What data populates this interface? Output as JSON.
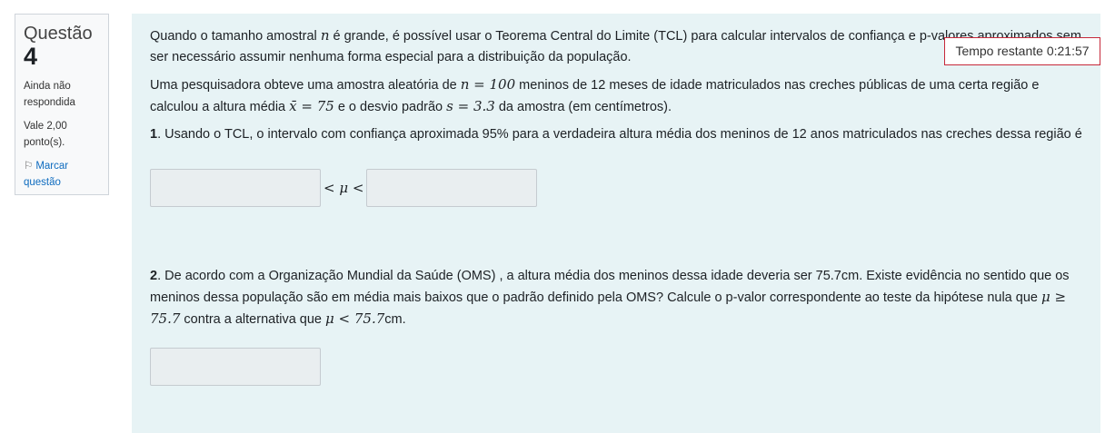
{
  "question": {
    "label": "Questão",
    "number": "4",
    "state": "Ainda não respondida",
    "grade": "Vale 2,00 ponto(s).",
    "flag_label": "Marcar questão"
  },
  "timer": {
    "label": "Tempo restante 0:21:57"
  },
  "content": {
    "intro_a": "Quando o tamanho amostral ",
    "intro_n": "n",
    "intro_b": " é grande, é possível usar o Teorema Central do Limite (TCL) para calcular intervalos de confiança e p-valores aproximados sem ser necessário assumir nenhuma forma especial para a distribuição da população.",
    "s1": "Uma pesquisadora obteve uma amostra aleatória de ",
    "n_eq": "n = 100",
    "s2": " meninos de 12 meses de idade matriculados nas creches públicas de uma certa região e calculou a altura média ",
    "xbar_eq": "x̄ = 75",
    "s3": " e o desvio padrão ",
    "s_eq": "s = 3.3",
    "s4": " da amostra (em centímetros).",
    "part1_label": "1",
    "part1_text": ". Usando o TCL, o intervalo com confiança aproximada 95% para a verdadeira altura média dos meninos de 12 anos matriculados nas creches dessa região é",
    "ineq_left": "< μ <",
    "part2_label": "2",
    "part2_text": ". De acordo com a Organização Mundial da Saúde (OMS) , a altura média dos meninos dessa idade deveria ser 75.7cm. Existe evidência no sentido que os meninos dessa população são em média mais baixos que o padrão definido pela OMS? Calcule o p-valor correspondente ao teste da hipótese nula que ",
    "h0": "μ ≥ 75.7",
    "part2_mid": " contra a alternativa que ",
    "h1": "μ < 75.7",
    "part2_end": "cm."
  }
}
